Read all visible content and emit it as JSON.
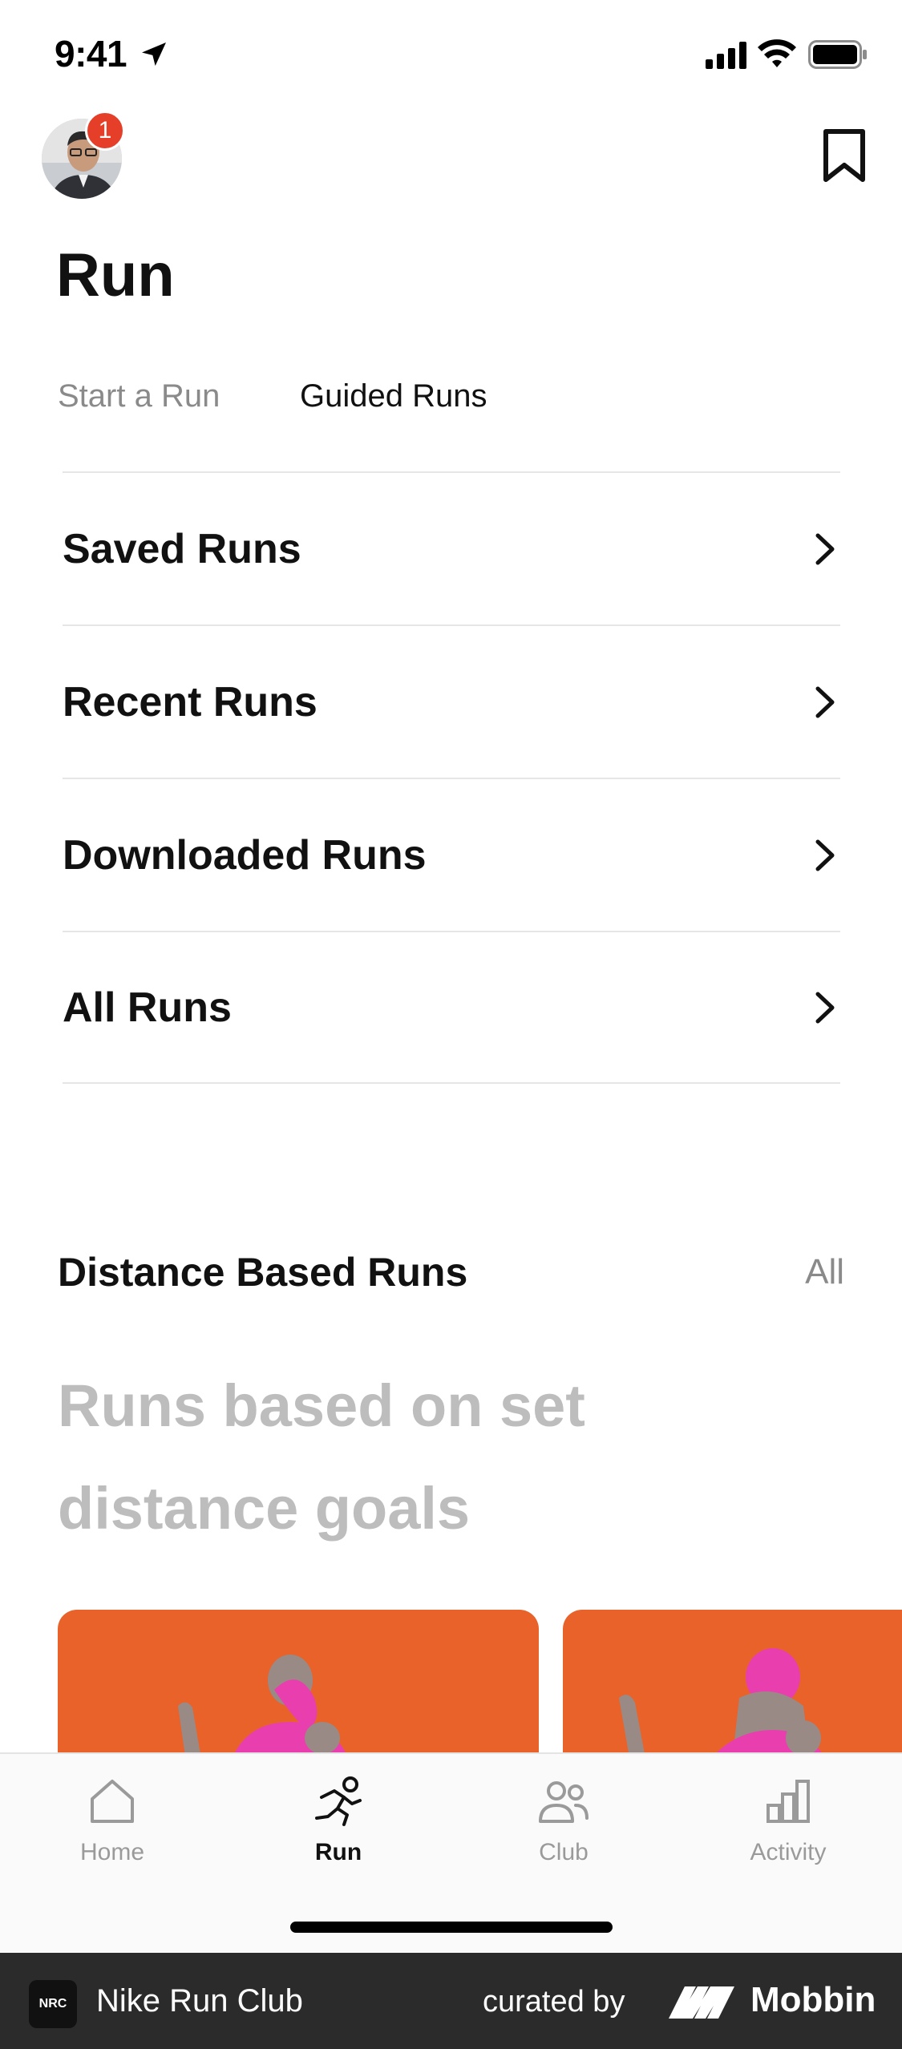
{
  "status_bar": {
    "time": "9:41"
  },
  "header": {
    "notification_count": "1",
    "title": "Run"
  },
  "tabs": [
    {
      "label": "Start a Run",
      "active": false
    },
    {
      "label": "Guided Runs",
      "active": true
    }
  ],
  "list": [
    {
      "label": "Saved Runs"
    },
    {
      "label": "Recent Runs"
    },
    {
      "label": "Downloaded Runs"
    },
    {
      "label": "All Runs"
    }
  ],
  "section": {
    "title": "Distance Based Runs",
    "all_label": "All",
    "description": "Runs based on set distance goals"
  },
  "tab_bar": {
    "items": [
      {
        "label": "Home",
        "icon": "home-icon",
        "active": false
      },
      {
        "label": "Run",
        "icon": "run-icon",
        "active": true
      },
      {
        "label": "Club",
        "icon": "club-icon",
        "active": false
      },
      {
        "label": "Activity",
        "icon": "activity-icon",
        "active": false
      }
    ]
  },
  "footer": {
    "app_name": "Nike Run Club",
    "logo_text": "NRC",
    "curated_by": "curated by",
    "brand": "Mobbin"
  },
  "colors": {
    "badge": "#e53f2a",
    "card_orange": "#e8622a",
    "card_figure": "#e93fae",
    "muted_text": "#8a8a8a"
  }
}
